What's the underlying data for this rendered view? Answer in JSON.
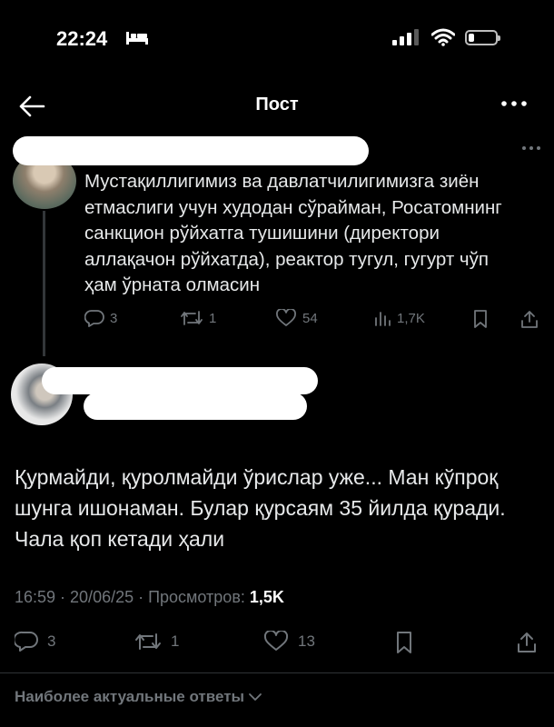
{
  "status_bar": {
    "time": "22:24"
  },
  "header": {
    "title": "Пост"
  },
  "quoted_post": {
    "text": "Мустақиллигимиз ва давлатчилигимизга зиён етмаслиги учун худодан сўрайман, Росатомнинг санкцион рўйхатга тушишини (директори аллақачон рўйхатда), реактор тугул, гугурт чўп ҳам ўрната олмасин",
    "replies": "3",
    "reposts": "1",
    "likes": "54",
    "views": "1,7K"
  },
  "main_post": {
    "text": "Қурмайди, қуролмайди ўрислар уже... Ман кўпроқ шунга ишонаман. Булар қурсаям 35 йилда қуради. Чала қоп кетади ҳали",
    "timestamp": "16:59 · 20/06/25 · Просмотров: ",
    "views": "1,5K",
    "replies": "3",
    "reposts": "1",
    "likes": "13"
  },
  "sort": {
    "label": "Наиболее актуальные ответы"
  }
}
